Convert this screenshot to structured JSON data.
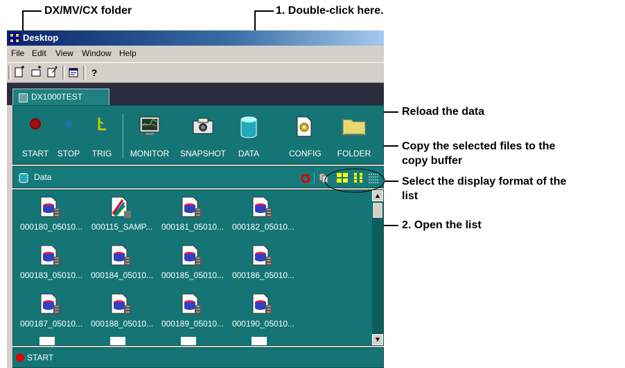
{
  "callouts": {
    "folder": "DX/MV/CX folder",
    "double_click": "1. Double-click here.",
    "reload": "Reload the data",
    "copy_line1": "Copy the selected files to the",
    "copy_line2": "copy buffer",
    "format_line1": "Select the display format of the",
    "format_line2": "list",
    "open_list": "2. Open the list"
  },
  "window": {
    "title": "Desktop",
    "menu": [
      "File",
      "Edit",
      "View",
      "Window",
      "Help"
    ],
    "toolbar_icons": [
      "new-icon",
      "new-folder-icon",
      "new-window-icon",
      "properties-icon",
      "help-icon"
    ]
  },
  "tab": {
    "label": "DX1000TEST"
  },
  "main_toolbar": {
    "start": "START",
    "stop": "STOP",
    "trig": "TRIG",
    "monitor": "MONITOR",
    "snapshot": "SNAPSHOT",
    "data": "DATA",
    "config": "CONFIG",
    "folder": "FOLDER"
  },
  "list_header": {
    "title": "Data"
  },
  "files": [
    "000180_05010...",
    "000115_SAMP...",
    "000181_05010...",
    "000182_05010...",
    "000183_05010...",
    "000184_05010...",
    "000185_05010...",
    "000186_05010...",
    "000187_05010...",
    "000188_05010...",
    "000189_05010...",
    "000190_05010..."
  ],
  "status": {
    "text": "START"
  },
  "colors": {
    "panel": "#157575",
    "tab_strip": "#2b2d3c",
    "title_bar": "#0a246a",
    "record": "#e00000"
  }
}
